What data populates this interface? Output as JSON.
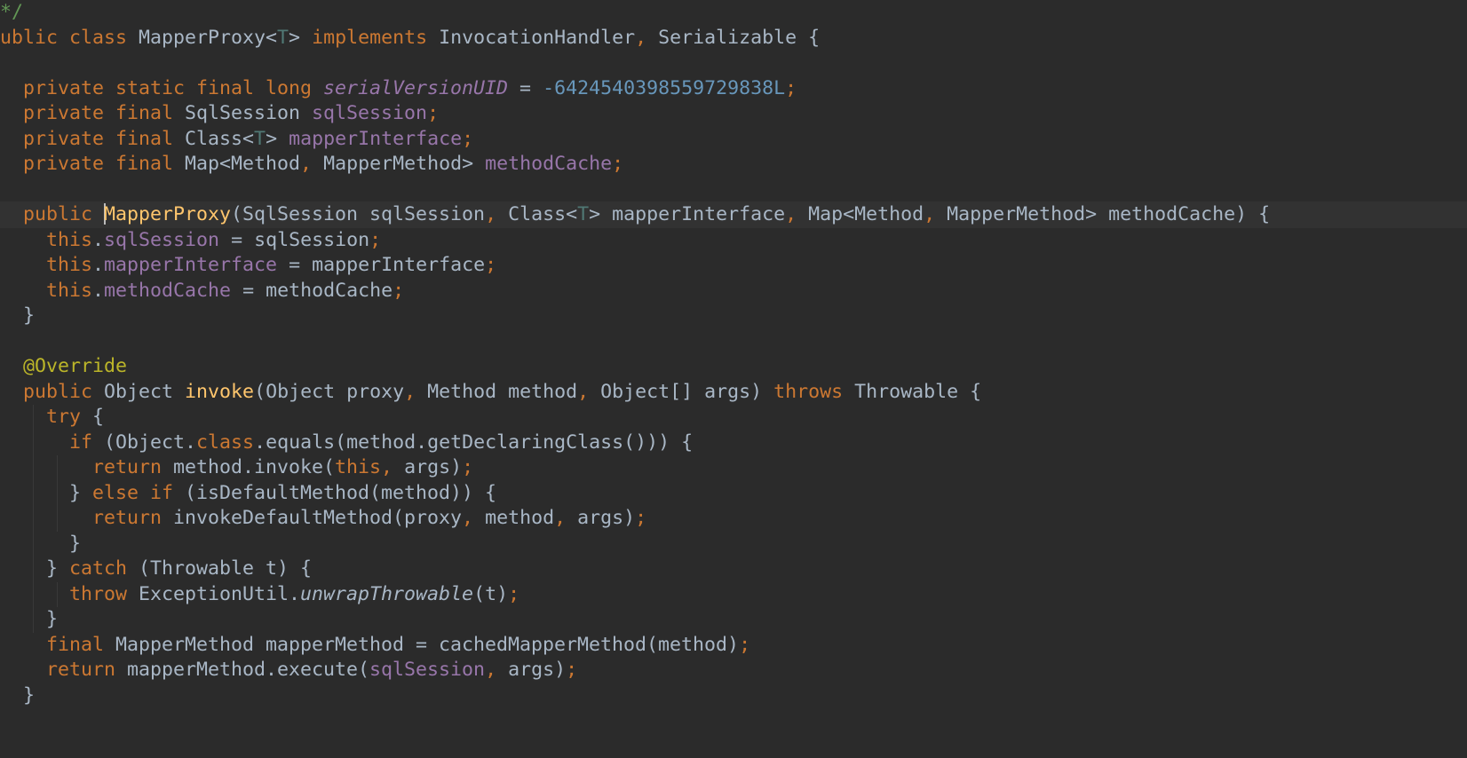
{
  "colors": {
    "background": "#2b2b2b",
    "current_line": "#323232",
    "plain": "#a9b7c6",
    "keyword": "#cc7832",
    "field": "#9876aa",
    "number": "#6897bb",
    "method_decl": "#ffc66d",
    "annotation": "#bbb529",
    "type_param": "#507874",
    "doc_comment": "#629755"
  },
  "editor": {
    "language": "java",
    "caret": {
      "line": 9,
      "column": 8
    },
    "lines": [
      {
        "tokens": [
          {
            "t": "*/",
            "c": "doc_comment"
          }
        ]
      },
      {
        "tokens": [
          {
            "t": "ublic class ",
            "c": "keyword"
          },
          {
            "t": "MapperProxy<",
            "c": "plain"
          },
          {
            "t": "T",
            "c": "type_param"
          },
          {
            "t": "> ",
            "c": "plain"
          },
          {
            "t": "implements ",
            "c": "keyword"
          },
          {
            "t": "InvocationHandler",
            "c": "plain"
          },
          {
            "t": ", ",
            "c": "keyword"
          },
          {
            "t": "Serializable {",
            "c": "plain"
          }
        ]
      },
      {
        "tokens": []
      },
      {
        "tokens": [
          {
            "t": "  "
          },
          {
            "t": "private static final long ",
            "c": "keyword"
          },
          {
            "t": "serialVersionUID",
            "c": "field",
            "i": true
          },
          {
            "t": " = ",
            "c": "plain"
          },
          {
            "t": "-6424540398559729838L",
            "c": "number"
          },
          {
            "t": ";",
            "c": "keyword"
          }
        ]
      },
      {
        "tokens": [
          {
            "t": "  "
          },
          {
            "t": "private final ",
            "c": "keyword"
          },
          {
            "t": "SqlSession ",
            "c": "plain"
          },
          {
            "t": "sqlSession",
            "c": "field"
          },
          {
            "t": ";",
            "c": "keyword"
          }
        ]
      },
      {
        "tokens": [
          {
            "t": "  "
          },
          {
            "t": "private final ",
            "c": "keyword"
          },
          {
            "t": "Class<",
            "c": "plain"
          },
          {
            "t": "T",
            "c": "type_param"
          },
          {
            "t": "> ",
            "c": "plain"
          },
          {
            "t": "mapperInterface",
            "c": "field"
          },
          {
            "t": ";",
            "c": "keyword"
          }
        ]
      },
      {
        "tokens": [
          {
            "t": "  "
          },
          {
            "t": "private final ",
            "c": "keyword"
          },
          {
            "t": "Map<Method",
            "c": "plain"
          },
          {
            "t": ", ",
            "c": "keyword"
          },
          {
            "t": "MapperMethod> ",
            "c": "plain"
          },
          {
            "t": "methodCache",
            "c": "field"
          },
          {
            "t": ";",
            "c": "keyword"
          }
        ]
      },
      {
        "tokens": []
      },
      {
        "current": true,
        "tokens": [
          {
            "t": "  "
          },
          {
            "t": "public ",
            "c": "keyword"
          },
          {
            "caret": true
          },
          {
            "t": "MapperProxy",
            "c": "method_decl"
          },
          {
            "t": "(SqlSession sqlSession",
            "c": "plain"
          },
          {
            "t": ", ",
            "c": "keyword"
          },
          {
            "t": "Class<",
            "c": "plain"
          },
          {
            "t": "T",
            "c": "type_param"
          },
          {
            "t": "> mapperInterface",
            "c": "plain"
          },
          {
            "t": ", ",
            "c": "keyword"
          },
          {
            "t": "Map<Method",
            "c": "plain"
          },
          {
            "t": ", ",
            "c": "keyword"
          },
          {
            "t": "MapperMethod> methodCache) {",
            "c": "plain"
          }
        ]
      },
      {
        "tokens": [
          {
            "t": "    "
          },
          {
            "t": "this",
            "c": "keyword"
          },
          {
            "t": ".",
            "c": "plain"
          },
          {
            "t": "sqlSession",
            "c": "field"
          },
          {
            "t": " = sqlSession",
            "c": "plain"
          },
          {
            "t": ";",
            "c": "keyword"
          }
        ]
      },
      {
        "tokens": [
          {
            "t": "    "
          },
          {
            "t": "this",
            "c": "keyword"
          },
          {
            "t": ".",
            "c": "plain"
          },
          {
            "t": "mapperInterface",
            "c": "field"
          },
          {
            "t": " = mapperInterface",
            "c": "plain"
          },
          {
            "t": ";",
            "c": "keyword"
          }
        ]
      },
      {
        "tokens": [
          {
            "t": "    "
          },
          {
            "t": "this",
            "c": "keyword"
          },
          {
            "t": ".",
            "c": "plain"
          },
          {
            "t": "methodCache",
            "c": "field"
          },
          {
            "t": " = methodCache",
            "c": "plain"
          },
          {
            "t": ";",
            "c": "keyword"
          }
        ]
      },
      {
        "tokens": [
          {
            "t": "  "
          },
          {
            "t": "}",
            "c": "plain"
          }
        ]
      },
      {
        "tokens": []
      },
      {
        "tokens": [
          {
            "t": "  "
          },
          {
            "t": "@Override",
            "c": "annotation"
          }
        ]
      },
      {
        "tokens": [
          {
            "t": "  "
          },
          {
            "t": "public ",
            "c": "keyword"
          },
          {
            "t": "Object ",
            "c": "plain"
          },
          {
            "t": "invoke",
            "c": "method_decl"
          },
          {
            "t": "(Object proxy",
            "c": "plain"
          },
          {
            "t": ", ",
            "c": "keyword"
          },
          {
            "t": "Method method",
            "c": "plain"
          },
          {
            "t": ", ",
            "c": "keyword"
          },
          {
            "t": "Object[] args) ",
            "c": "plain"
          },
          {
            "t": "throws ",
            "c": "keyword"
          },
          {
            "t": "Throwable {",
            "c": "plain"
          }
        ]
      },
      {
        "tokens": [
          {
            "t": "    "
          },
          {
            "t": "try ",
            "c": "keyword"
          },
          {
            "t": "{",
            "c": "plain"
          }
        ]
      },
      {
        "tokens": [
          {
            "t": "      "
          },
          {
            "t": "if ",
            "c": "keyword"
          },
          {
            "t": "(Object.",
            "c": "plain"
          },
          {
            "t": "class",
            "c": "keyword"
          },
          {
            "t": ".equals(method.getDeclaringClass())) {",
            "c": "plain"
          }
        ]
      },
      {
        "tokens": [
          {
            "t": "        "
          },
          {
            "t": "return ",
            "c": "keyword"
          },
          {
            "t": "method.invoke(",
            "c": "plain"
          },
          {
            "t": "this, ",
            "c": "keyword"
          },
          {
            "t": "args)",
            "c": "plain"
          },
          {
            "t": ";",
            "c": "keyword"
          }
        ]
      },
      {
        "tokens": [
          {
            "t": "      "
          },
          {
            "t": "} ",
            "c": "plain"
          },
          {
            "t": "else if ",
            "c": "keyword"
          },
          {
            "t": "(isDefaultMethod(method)) {",
            "c": "plain"
          }
        ]
      },
      {
        "tokens": [
          {
            "t": "        "
          },
          {
            "t": "return ",
            "c": "keyword"
          },
          {
            "t": "invokeDefaultMethod(proxy",
            "c": "plain"
          },
          {
            "t": ", ",
            "c": "keyword"
          },
          {
            "t": "method",
            "c": "plain"
          },
          {
            "t": ", ",
            "c": "keyword"
          },
          {
            "t": "args)",
            "c": "plain"
          },
          {
            "t": ";",
            "c": "keyword"
          }
        ]
      },
      {
        "tokens": [
          {
            "t": "      "
          },
          {
            "t": "}",
            "c": "plain"
          }
        ]
      },
      {
        "tokens": [
          {
            "t": "    "
          },
          {
            "t": "} ",
            "c": "plain"
          },
          {
            "t": "catch ",
            "c": "keyword"
          },
          {
            "t": "(Throwable t) {",
            "c": "plain"
          }
        ]
      },
      {
        "tokens": [
          {
            "t": "      "
          },
          {
            "t": "throw ",
            "c": "keyword"
          },
          {
            "t": "ExceptionUtil.",
            "c": "plain"
          },
          {
            "t": "unwrapThrowable",
            "c": "plain",
            "i": true
          },
          {
            "t": "(t)",
            "c": "plain"
          },
          {
            "t": ";",
            "c": "keyword"
          }
        ]
      },
      {
        "tokens": [
          {
            "t": "    "
          },
          {
            "t": "}",
            "c": "plain"
          }
        ]
      },
      {
        "tokens": [
          {
            "t": "    "
          },
          {
            "t": "final ",
            "c": "keyword"
          },
          {
            "t": "MapperMethod mapperMethod = cachedMapperMethod(method)",
            "c": "plain"
          },
          {
            "t": ";",
            "c": "keyword"
          }
        ]
      },
      {
        "tokens": [
          {
            "t": "    "
          },
          {
            "t": "return ",
            "c": "keyword"
          },
          {
            "t": "mapperMethod.execute(",
            "c": "plain"
          },
          {
            "t": "sqlSession",
            "c": "field"
          },
          {
            "t": ", ",
            "c": "keyword"
          },
          {
            "t": "args)",
            "c": "plain"
          },
          {
            "t": ";",
            "c": "keyword"
          }
        ]
      },
      {
        "tokens": [
          {
            "t": "  "
          },
          {
            "t": "}",
            "c": "plain"
          }
        ]
      }
    ]
  }
}
